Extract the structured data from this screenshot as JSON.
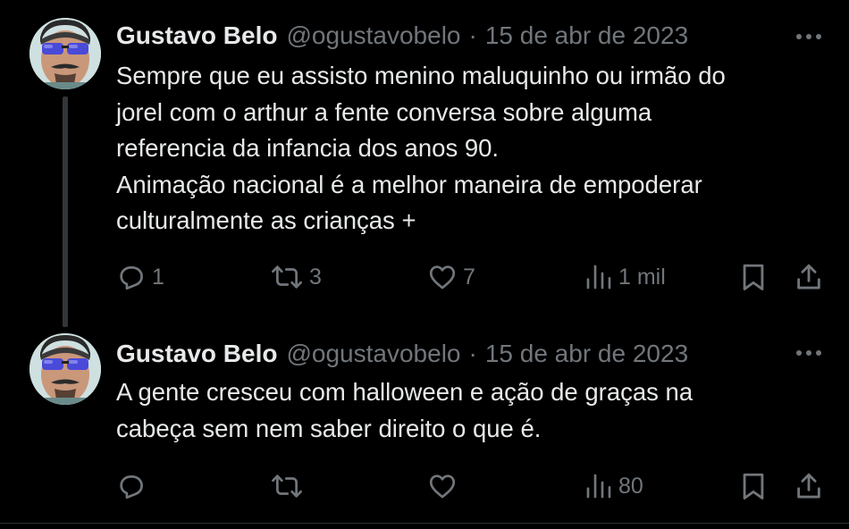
{
  "colors": {
    "background": "#000000",
    "primary_text": "#e7e9ea",
    "secondary_text": "#71767b",
    "thread_line": "#333639"
  },
  "tweets": [
    {
      "author": {
        "name": "Gustavo Belo",
        "handle": "@ogustavobelo",
        "avatar_icon": "avatar-photo"
      },
      "separator": "·",
      "date": "15 de abr de 2023",
      "lines": [
        "Sempre que eu assisto menino maluquinho ou irmão do",
        "jorel com o arthur a fente conversa sobre alguma",
        "referencia da infancia dos anos 90.",
        "Animação nacional é a melhor maneira de empoderar",
        "culturalmente as crianças +"
      ],
      "actions": {
        "reply_count": "1",
        "retweet_count": "3",
        "like_count": "7",
        "views_count": "1 mil"
      }
    },
    {
      "author": {
        "name": "Gustavo Belo",
        "handle": "@ogustavobelo",
        "avatar_icon": "avatar-photo"
      },
      "separator": "·",
      "date": "15 de abr de 2023",
      "lines": [
        "A gente cresceu com halloween e ação de graças na",
        "cabeça sem nem saber direito o que é."
      ],
      "actions": {
        "reply_count": "",
        "retweet_count": "",
        "like_count": "",
        "views_count": "80"
      }
    }
  ],
  "icons": {
    "more": "more-horizontal-icon",
    "reply": "reply-icon",
    "retweet": "retweet-icon",
    "like": "heart-icon",
    "views": "views-chart-icon",
    "bookmark": "bookmark-icon",
    "share": "share-icon"
  }
}
